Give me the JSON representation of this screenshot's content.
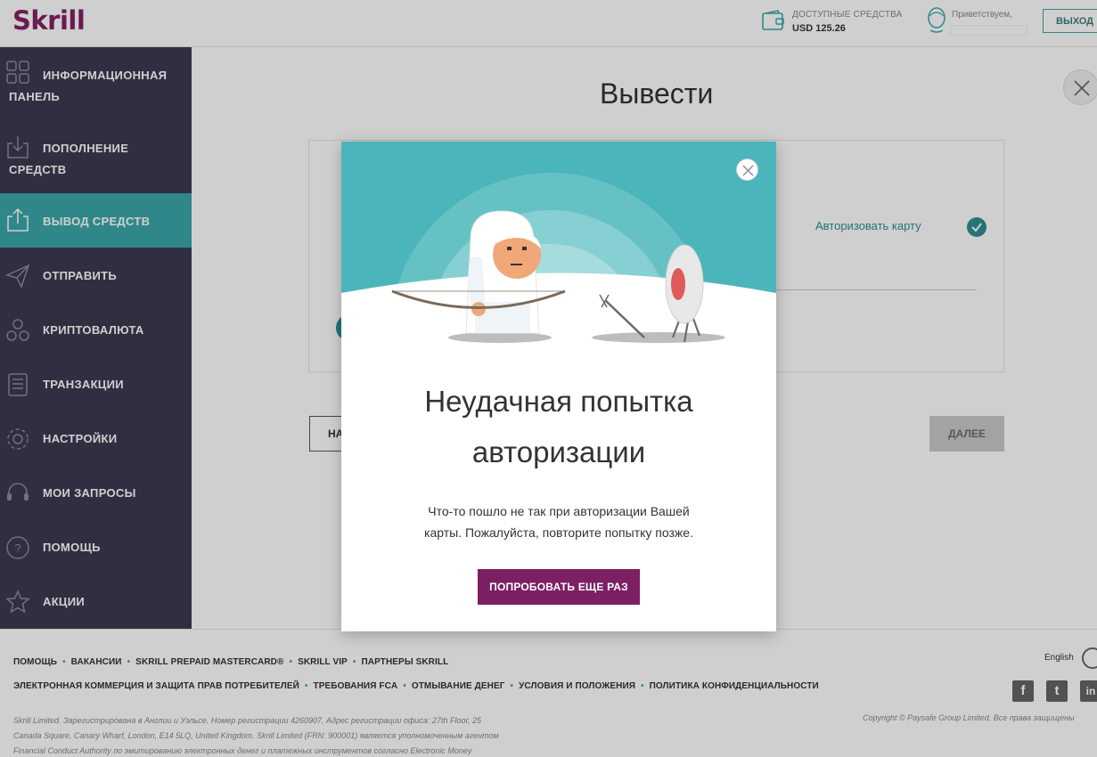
{
  "header": {
    "logo": "Skrill",
    "funds_label": "ДОСТУПНЫЕ СРЕДСТВА",
    "funds_value": "USD 125.26",
    "greeting": "Приветствуем,",
    "logout": "ВЫХОД"
  },
  "sidebar": {
    "items": [
      {
        "line1": "ИНФОРМАЦИОННАЯ",
        "line2": "ПАНЕЛЬ"
      },
      {
        "line1": "ПОПОЛНЕНИЕ",
        "line2": "СРЕДСТВ"
      },
      {
        "label": "ВЫВОД СРЕДСТВ"
      },
      {
        "label": "ОТПРАВИТЬ"
      },
      {
        "label": "КРИПТОВАЛЮТА"
      },
      {
        "label": "ТРАНЗАКЦИИ"
      },
      {
        "label": "НАСТРОЙКИ"
      },
      {
        "label": "МОИ ЗАПРОСЫ"
      },
      {
        "label": "ПОМОЩЬ"
      },
      {
        "label": "АКЦИИ"
      }
    ]
  },
  "main": {
    "title": "Вывести",
    "authorize_card": "Авторизовать карту",
    "back_label": "НА",
    "next_label": "ДАЛЕЕ"
  },
  "modal": {
    "title_line1": "Неудачная попытка",
    "title_line2": "авторизации",
    "text_line1": "Что-то пошло не так при авторизации Вашей",
    "text_line2": "карты. Пожалуйста, повторите попытку позже.",
    "retry_button": "ПОПРОБОВАТЬ ЕЩЕ РАЗ"
  },
  "footer": {
    "links_row1": [
      "ПОМОЩЬ",
      "ВАКАНСИИ",
      "SKRILL PREPAID MASTERCARD®",
      "SKRILL VIP",
      "ПАРТНЕРЫ SKRILL"
    ],
    "links_row2": [
      "ЭЛЕКТРОННАЯ КОММЕРЦИЯ И ЗАЩИТА ПРАВ ПОТРЕБИТЕЛЕЙ",
      "ТРЕБОВАНИЯ FCA",
      "ОТМЫВАНИЕ ДЕНЕГ",
      "УСЛОВИЯ И ПОЛОЖЕНИЯ",
      "ПОЛИТИКА КОНФИДЕНЦИАЛЬНОСТИ"
    ],
    "legal_line1": "Skrill Limited. Зарегистрирована в Англии и Уэльсе. Номер регистрации 4260907. Адрес регистрации офиса: 27th Floor, 25",
    "legal_line2": "Canada Square, Canary Wharf, London, E14 5LQ, United Kingdom. Skrill Limited (FRN: 900001) является уполномоченным агентом",
    "legal_line3": "Financial Conduct Authority по эмитированию электронных денег и платежных инструментов согласно Electronic Money",
    "copyright": "Copyright © Paysafe Group Limited. Все права защищены",
    "language": "English",
    "social": [
      "f",
      "t",
      "in"
    ]
  },
  "colors": {
    "brand": "#862165",
    "teal": "#3aa7a9",
    "sidebar": "#3c3a52",
    "retry": "#7c1f63"
  }
}
